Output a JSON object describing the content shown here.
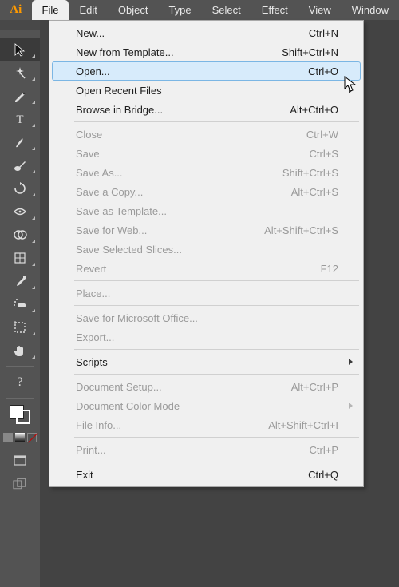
{
  "app": {
    "logo": "Ai"
  },
  "menubar": {
    "items": [
      {
        "label": "File",
        "active": true
      },
      {
        "label": "Edit"
      },
      {
        "label": "Object"
      },
      {
        "label": "Type"
      },
      {
        "label": "Select"
      },
      {
        "label": "Effect"
      },
      {
        "label": "View"
      },
      {
        "label": "Window"
      }
    ]
  },
  "dropdown": {
    "items": [
      {
        "label": "New...",
        "shortcut": "Ctrl+N"
      },
      {
        "label": "New from Template...",
        "shortcut": "Shift+Ctrl+N"
      },
      {
        "label": "Open...",
        "shortcut": "Ctrl+O",
        "hovered": true
      },
      {
        "label": "Open Recent Files",
        "submenu": true
      },
      {
        "label": "Browse in Bridge...",
        "shortcut": "Alt+Ctrl+O"
      },
      {
        "sep": true
      },
      {
        "label": "Close",
        "shortcut": "Ctrl+W",
        "disabled": true
      },
      {
        "label": "Save",
        "shortcut": "Ctrl+S",
        "disabled": true
      },
      {
        "label": "Save As...",
        "shortcut": "Shift+Ctrl+S",
        "disabled": true
      },
      {
        "label": "Save a Copy...",
        "shortcut": "Alt+Ctrl+S",
        "disabled": true
      },
      {
        "label": "Save as Template...",
        "disabled": true
      },
      {
        "label": "Save for Web...",
        "shortcut": "Alt+Shift+Ctrl+S",
        "disabled": true
      },
      {
        "label": "Save Selected Slices...",
        "disabled": true
      },
      {
        "label": "Revert",
        "shortcut": "F12",
        "disabled": true
      },
      {
        "sep": true
      },
      {
        "label": "Place...",
        "disabled": true
      },
      {
        "sep": true
      },
      {
        "label": "Save for Microsoft Office...",
        "disabled": true
      },
      {
        "label": "Export...",
        "disabled": true
      },
      {
        "sep": true
      },
      {
        "label": "Scripts",
        "submenu": true
      },
      {
        "sep": true
      },
      {
        "label": "Document Setup...",
        "shortcut": "Alt+Ctrl+P",
        "disabled": true
      },
      {
        "label": "Document Color Mode",
        "submenu": true,
        "disabled": true
      },
      {
        "label": "File Info...",
        "shortcut": "Alt+Shift+Ctrl+I",
        "disabled": true
      },
      {
        "sep": true
      },
      {
        "label": "Print...",
        "shortcut": "Ctrl+P",
        "disabled": true
      },
      {
        "sep": true
      },
      {
        "label": "Exit",
        "shortcut": "Ctrl+Q"
      }
    ]
  },
  "tools": [
    {
      "name": "selection-tool",
      "selected": true
    },
    {
      "name": "magic-wand-tool"
    },
    {
      "name": "pen-tool"
    },
    {
      "name": "type-tool"
    },
    {
      "name": "paintbrush-tool"
    },
    {
      "name": "blob-brush-tool"
    },
    {
      "name": "rotate-tool"
    },
    {
      "name": "width-tool"
    },
    {
      "name": "shape-builder-tool"
    },
    {
      "name": "mesh-tool"
    },
    {
      "name": "eyedropper-tool"
    },
    {
      "name": "symbol-sprayer-tool"
    },
    {
      "name": "artboard-tool"
    },
    {
      "name": "hand-tool"
    }
  ]
}
